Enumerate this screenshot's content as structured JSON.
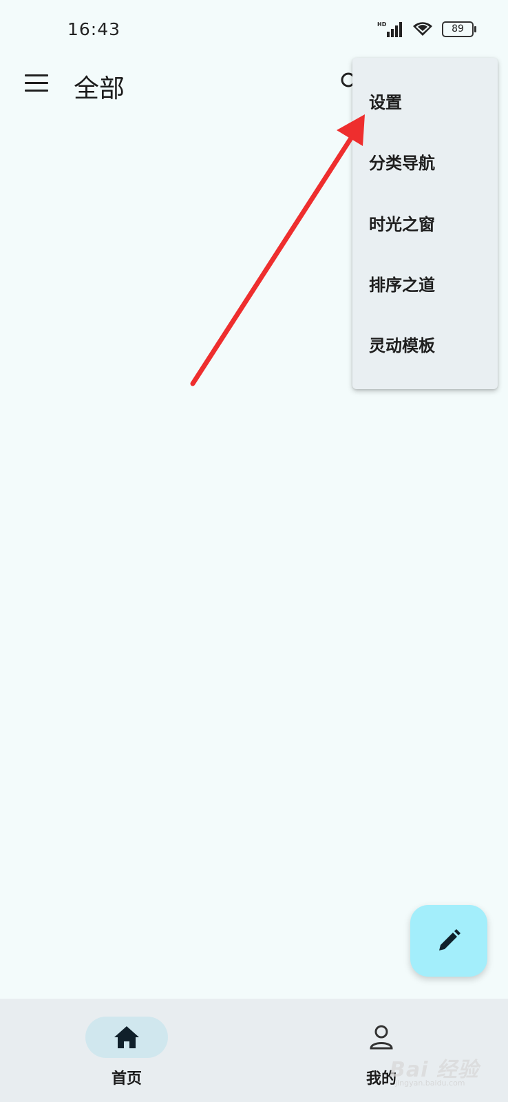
{
  "status_bar": {
    "time": "16:43",
    "network_label": "HD",
    "battery_level": "89"
  },
  "app_bar": {
    "title": "全部",
    "menu_icon": "hamburger-menu-icon",
    "search_icon": "search-icon"
  },
  "dropdown_menu": {
    "items": [
      {
        "label": "设置"
      },
      {
        "label": "分类导航"
      },
      {
        "label": "时光之窗"
      },
      {
        "label": "排序之道"
      },
      {
        "label": "灵动模板"
      }
    ]
  },
  "fab": {
    "icon": "edit-pencil-icon",
    "color": "#a3eefb"
  },
  "bottom_nav": {
    "items": [
      {
        "label": "首页",
        "icon": "home-icon",
        "selected": true
      },
      {
        "label": "我的",
        "icon": "person-icon",
        "selected": false
      }
    ]
  },
  "annotation": {
    "arrow_color": "#ee2e2e"
  },
  "watermark": {
    "text": "Bai 经验",
    "url": "jingyan.baidu.com"
  }
}
